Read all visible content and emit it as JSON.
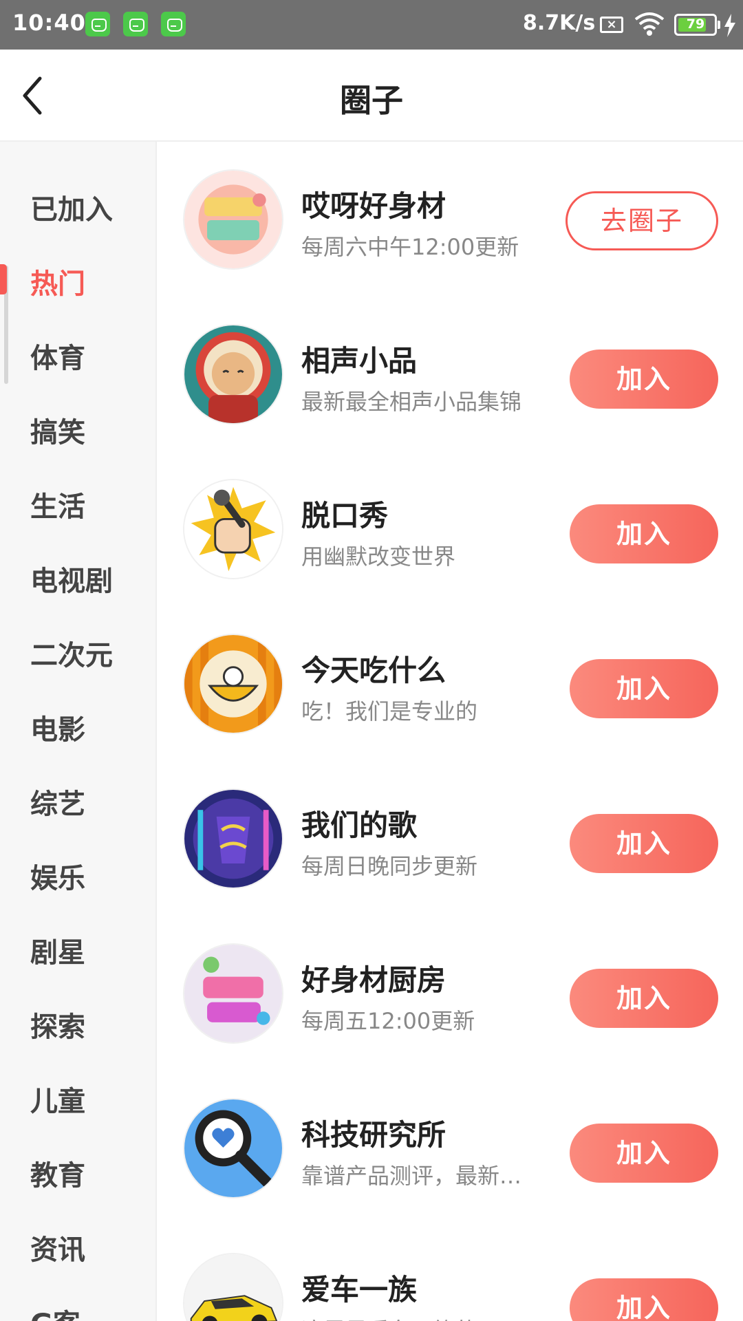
{
  "status_bar": {
    "time": "10:40",
    "notifications": [
      "notif-app-icon",
      "notif-app-icon",
      "notif-app-icon"
    ],
    "network_speed": "8.7K/s",
    "battery_level": "79",
    "battery_fraction": 0.79,
    "accent_green": "#6ccf3f"
  },
  "header": {
    "title": "圈子",
    "back_icon": "chevron-left-icon"
  },
  "sidebar": {
    "active_index": 1,
    "items": [
      {
        "label": "已加入"
      },
      {
        "label": "热门"
      },
      {
        "label": "体育"
      },
      {
        "label": "搞笑"
      },
      {
        "label": "生活"
      },
      {
        "label": "电视剧"
      },
      {
        "label": "二次元"
      },
      {
        "label": "电影"
      },
      {
        "label": "综艺"
      },
      {
        "label": "娱乐"
      },
      {
        "label": "剧星"
      },
      {
        "label": "探索"
      },
      {
        "label": "儿童"
      },
      {
        "label": "教育"
      },
      {
        "label": "资讯"
      },
      {
        "label": "G客"
      }
    ]
  },
  "circles": [
    {
      "title": "哎呀好身材",
      "subtitle": "每周六中午12:00更新",
      "action": "去圈子",
      "joined": true,
      "avatar": "show-logo-image"
    },
    {
      "title": "相声小品",
      "subtitle": "最新最全相声小品集锦",
      "action": "加入",
      "joined": false,
      "avatar": "cartoon-face-image"
    },
    {
      "title": "脱口秀",
      "subtitle": "用幽默改变世界",
      "action": "加入",
      "joined": false,
      "avatar": "fist-microphone-image"
    },
    {
      "title": "今天吃什么",
      "subtitle": "吃！我们是专业的",
      "action": "加入",
      "joined": false,
      "avatar": "food-bowl-image"
    },
    {
      "title": "我们的歌",
      "subtitle": "每周日晚同步更新",
      "action": "加入",
      "joined": false,
      "avatar": "music-show-image"
    },
    {
      "title": "好身材厨房",
      "subtitle": "每周五12:00更新",
      "action": "加入",
      "joined": false,
      "avatar": "kitchen-show-image"
    },
    {
      "title": "科技研究所",
      "subtitle": "靠谱产品测评，最新科技资讯",
      "action": "加入",
      "joined": false,
      "avatar": "magnifier-heart-image"
    },
    {
      "title": "爱车一族",
      "subtitle": "这里是爱车一族的",
      "action": "加入",
      "joined": false,
      "avatar": "yellow-car-image"
    }
  ],
  "colors": {
    "accent": "#f65a55",
    "button_gradient_start": "#fb8a7d",
    "button_gradient_end": "#f6655b",
    "statusbar_bg": "#707070"
  }
}
